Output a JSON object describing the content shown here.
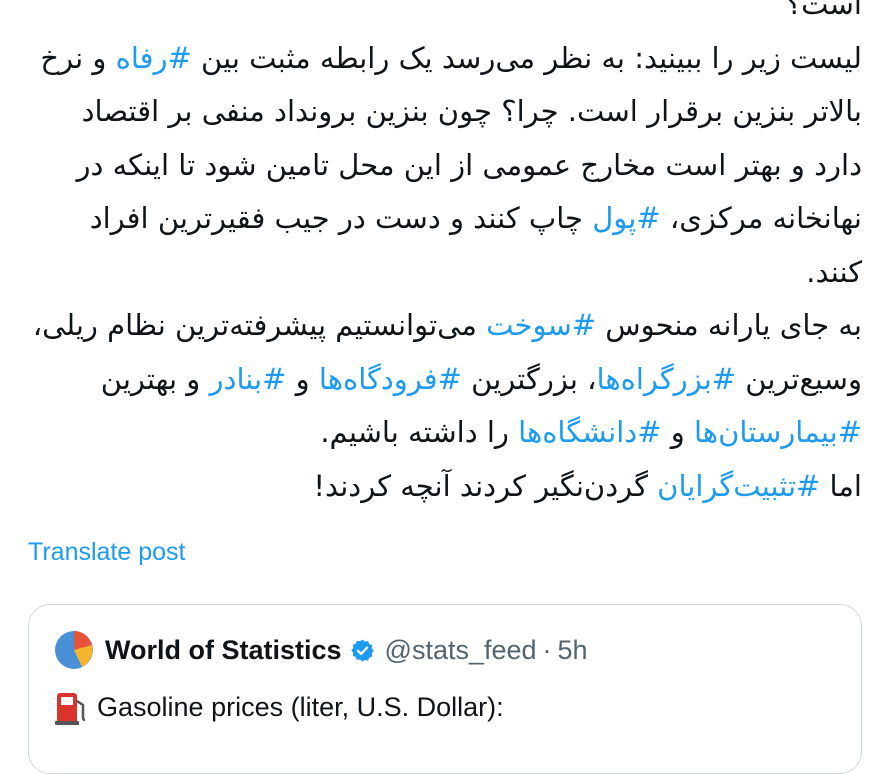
{
  "post": {
    "line0": "است؟",
    "paragraphs": [
      [
        {
          "text": "لیست زیر را ببینید: به نظر می‌رسد یک رابطه مثبت بین ",
          "tag": false
        },
        {
          "text": "#رفاه",
          "tag": true
        },
        {
          "text": " و نرخ بالاتر بنزین برقرار است. چرا؟ چون بنزین برونداد منفی بر اقتصاد دارد و بهتر است مخارج عمومی از این محل تامین شود تا اینکه در نهانخانه مرکزی، ",
          "tag": false
        },
        {
          "text": "#پول",
          "tag": true
        },
        {
          "text": " چاپ کنند و دست در جیب فقیرترین افراد کنند.",
          "tag": false
        }
      ],
      [
        {
          "text": "به جای یارانه منحوس ",
          "tag": false
        },
        {
          "text": "#سوخت",
          "tag": true
        },
        {
          "text": " می‌توانستیم پیشرفته‌ترین نظام ریلی، وسیع‌ترین ",
          "tag": false
        },
        {
          "text": "#بزرگراه‌ها",
          "tag": true
        },
        {
          "text": "، بزرگترین ",
          "tag": false
        },
        {
          "text": "#فرودگاه‌ها",
          "tag": true
        },
        {
          "text": " و ",
          "tag": false
        },
        {
          "text": "#بنادر",
          "tag": true
        },
        {
          "text": " و بهترین ",
          "tag": false
        },
        {
          "text": "#بیمارستان‌ها",
          "tag": true
        },
        {
          "text": " و ",
          "tag": false
        },
        {
          "text": "#دانشگاه‌ها",
          "tag": true
        },
        {
          "text": " را داشته باشیم.",
          "tag": false
        }
      ],
      [
        {
          "text": "اما ",
          "tag": false
        },
        {
          "text": "#تثبیت‌گرایان",
          "tag": true
        },
        {
          "text": " گردن‌نگیر کردند آنچه کردند!",
          "tag": false
        }
      ]
    ]
  },
  "translate_label": "Translate post",
  "quote": {
    "author_name": "World of Statistics",
    "handle": "@stats_feed",
    "separator": "·",
    "time": "5h",
    "text": "Gasoline prices (liter, U.S. Dollar):",
    "icons": {
      "avatar": "pie-chart-avatar",
      "verified": "verified-badge-icon",
      "emoji": "fuel-pump-icon"
    }
  },
  "colors": {
    "link": "#1d9bf0",
    "text": "#0f1419",
    "muted": "#536471",
    "border": "#cfd9de"
  }
}
